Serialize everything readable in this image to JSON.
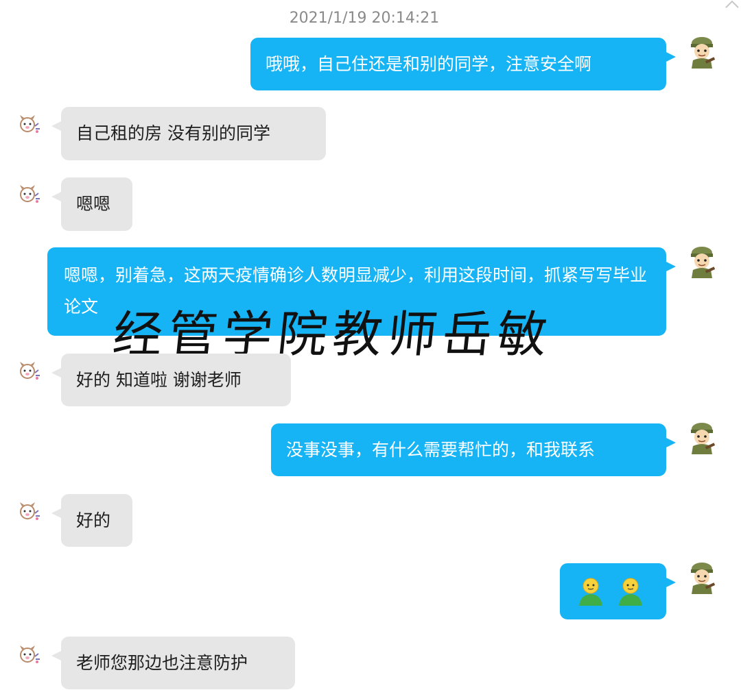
{
  "chat": {
    "timestamp": "2021/1/19 20:14:21",
    "messages": [
      {
        "from": "me",
        "text": "哦哦，自己住还是和别的同学，注意安全啊"
      },
      {
        "from": "other",
        "text": "自己租的房 没有别的同学"
      },
      {
        "from": "other",
        "text": "嗯嗯"
      },
      {
        "from": "me",
        "text": "嗯嗯，别着急，这两天疫情确诊人数明显减少，利用这段时间，抓紧写写毕业论文"
      },
      {
        "from": "other",
        "text": "好的 知道啦 谢谢老师"
      },
      {
        "from": "me",
        "text": "没事没事，有什么需要帮忙的，和我联系"
      },
      {
        "from": "other",
        "text": "好的"
      },
      {
        "from": "me",
        "emoji": [
          "person-emoji",
          "person-emoji"
        ]
      },
      {
        "from": "other",
        "text": "老师您那边也注意防护"
      }
    ]
  },
  "watermark": "经管学院教师岳敏",
  "colors": {
    "outgoing_bubble": "#16b4f5",
    "incoming_bubble": "#e6e6e6",
    "background": "#ffffff"
  },
  "icons": {
    "scroll": "chevron-up-icon",
    "my_avatar": "soldier-avatar-icon",
    "other_avatar": "pig-avatar-icon"
  }
}
